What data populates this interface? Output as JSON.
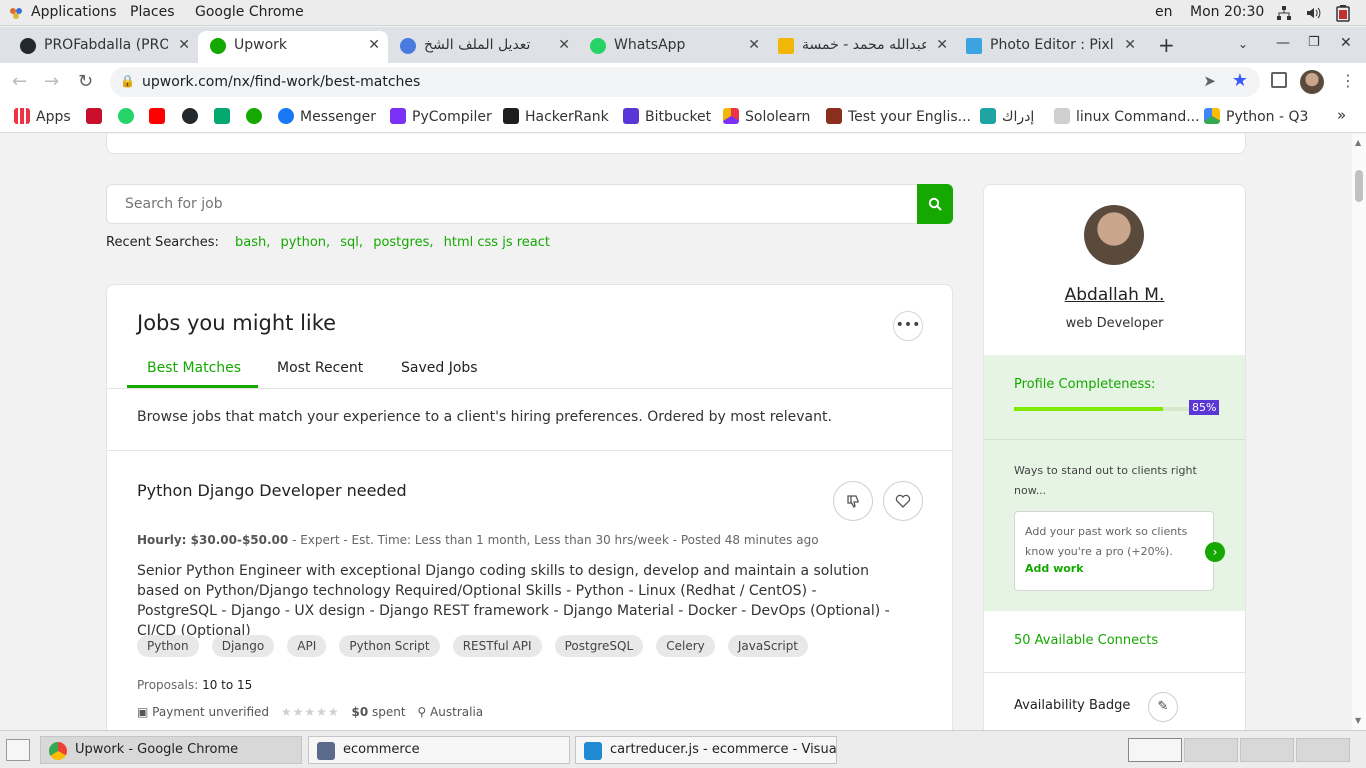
{
  "system_bar": {
    "applications": "Applications",
    "places": "Places",
    "active_app": "Google Chrome",
    "lang": "en",
    "clock": "Mon 20:30"
  },
  "tabs": [
    {
      "title": "PROFabdalla (PROF",
      "active": false
    },
    {
      "title": "Upwork",
      "active": true
    },
    {
      "title": "تعديل الملف الشخ",
      "active": false
    },
    {
      "title": "WhatsApp",
      "active": false
    },
    {
      "title": "عبدالله محمد - خمسة",
      "active": false
    },
    {
      "title": "Photo Editor : Pixlr",
      "active": false
    }
  ],
  "address_bar": {
    "url": "upwork.com/nx/find-work/best-matches"
  },
  "bookmarks": [
    {
      "label": "Apps"
    },
    {
      "label": "Messenger"
    },
    {
      "label": "PyCompiler"
    },
    {
      "label": "HackerRank"
    },
    {
      "label": "Bitbucket"
    },
    {
      "label": "Sololearn"
    },
    {
      "label": "Test your Englis..."
    },
    {
      "label": "إدراك"
    },
    {
      "label": "linux Command..."
    },
    {
      "label": "Python - Q3"
    }
  ],
  "search": {
    "placeholder": "Search for job",
    "recent_label": "Recent Searches:",
    "recent": [
      "bash,",
      "python,",
      "sql,",
      "postgres,",
      "html css js react"
    ]
  },
  "jobs": {
    "title": "Jobs you might like",
    "tabs": [
      "Best Matches",
      "Most Recent",
      "Saved Jobs"
    ],
    "description": "Browse jobs that match your experience to a client's hiring preferences. Ordered by most relevant.",
    "job": {
      "title": "Python Django Developer needed",
      "rate": "Hourly: $30.00-$50.00",
      "meta_rest": " - Expert - Est. Time: Less than 1 month, Less than 30 hrs/week - Posted 48 minutes ago",
      "description": "Senior Python Engineer with exceptional Django coding skills to design, develop and maintain a solution based on Python/Django technology Required/Optional Skills - Python - Linux (Redhat / CentOS) - PostgreSQL - Django - UX design - Django REST framework - Django Material - Docker - DevOps (Optional) - CI/CD (Optional)",
      "skills": [
        "Python",
        "Django",
        "API",
        "Python Script",
        "RESTful API",
        "PostgreSQL",
        "Celery",
        "JavaScript"
      ],
      "proposals_label": "Proposals:",
      "proposals_value": "10 to 15",
      "payment": "Payment unverified",
      "spent_amount": "$0",
      "spent_label": "spent",
      "location": "Australia"
    }
  },
  "profile": {
    "name": "Abdallah M.",
    "role": "web Developer",
    "completeness_label": "Profile Completeness:",
    "completeness_pct": 85,
    "completeness_text": "85%",
    "standout": "Ways to stand out to clients right now...",
    "addwork_text": "Add your past work so clients know you're a pro (+20%).",
    "addwork_link": "Add work",
    "connects": "50 Available Connects",
    "availability": "Availability Badge"
  },
  "taskbar": [
    {
      "label": "Upwork - Google Chrome",
      "active": true
    },
    {
      "label": "ecommerce",
      "active": false
    },
    {
      "label": "cartreducer.js - ecommerce - Visual ...",
      "active": false
    }
  ],
  "colors": {
    "accent": "#14a800",
    "progress": "#7fe900",
    "badge": "#5a36d6"
  }
}
